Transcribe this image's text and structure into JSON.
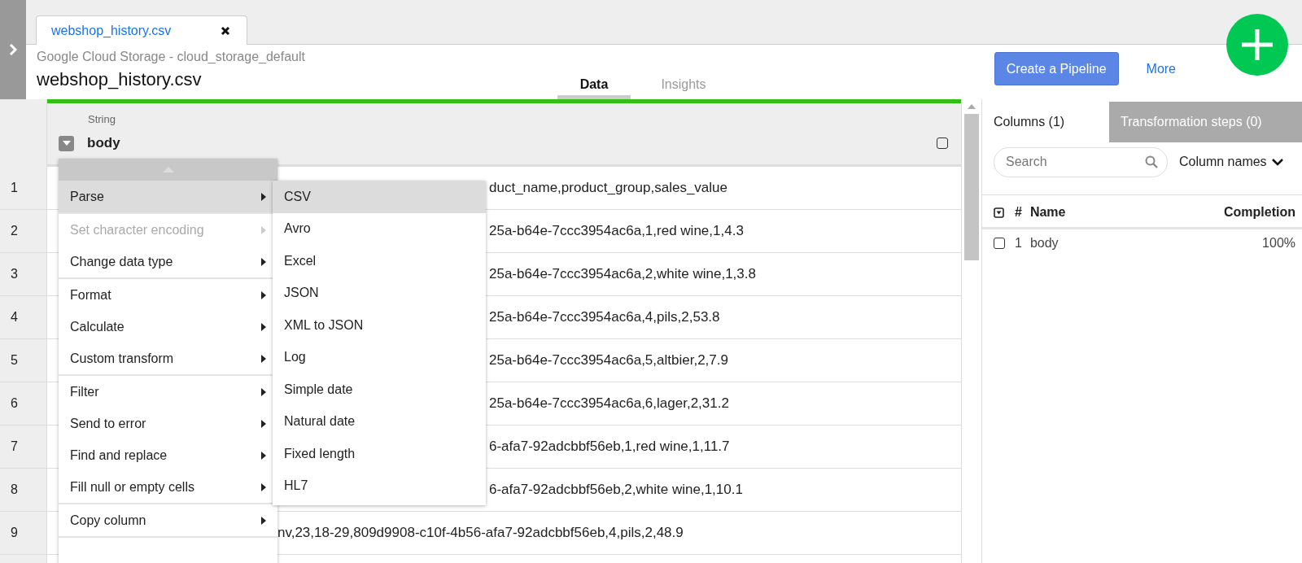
{
  "file_tab": {
    "label": "webshop_history.csv"
  },
  "header": {
    "source": "Google Cloud Storage - cloud_storage_default",
    "title": "webshop_history.csv"
  },
  "view_tabs": [
    {
      "label": "Data",
      "selected": true
    },
    {
      "label": "Insights",
      "selected": false
    }
  ],
  "actions": {
    "primary": "Create a Pipeline",
    "link": "More"
  },
  "table": {
    "column": {
      "type": "String",
      "name": "body",
      "checked": false
    },
    "rows": [
      {
        "number": "1",
        "value": "duct_name,product_group,sales_value"
      },
      {
        "number": "2",
        "value": "25a-b64e-7ccc3954ac6a,1,red wine,1,4.3"
      },
      {
        "number": "3",
        "value": "25a-b64e-7ccc3954ac6a,2,white wine,1,3.8"
      },
      {
        "number": "4",
        "value": "25a-b64e-7ccc3954ac6a,4,pils,2,53.8"
      },
      {
        "number": "5",
        "value": "25a-b64e-7ccc3954ac6a,5,altbier,2,7.9"
      },
      {
        "number": "6",
        "value": "25a-b64e-7ccc3954ac6a,6,lager,2,31.2"
      },
      {
        "number": "7",
        "value": "6-afa7-92adcbbf56eb,1,red wine,1,11.7"
      },
      {
        "number": "8",
        "value": "6-afa7-92adcbbf56eb,2,white wine,1,10.1"
      },
      {
        "number": "9",
        "value": "nv,23,18-29,809d9908-c10f-4b56-afa7-92adcbbf56eb,4,pils,2,48.9"
      }
    ]
  },
  "context_menu": {
    "groups": [
      [
        {
          "label": "Parse",
          "selected": true,
          "disabled": false
        }
      ],
      [
        {
          "label": "Set character encoding",
          "selected": false,
          "disabled": true
        },
        {
          "label": "Change data type",
          "selected": false,
          "disabled": false
        }
      ],
      [
        {
          "label": "Format",
          "selected": false,
          "disabled": false
        },
        {
          "label": "Calculate",
          "selected": false,
          "disabled": false
        },
        {
          "label": "Custom transform",
          "selected": false,
          "disabled": false
        }
      ],
      [
        {
          "label": "Filter",
          "selected": false,
          "disabled": false
        },
        {
          "label": "Send to error",
          "selected": false,
          "disabled": false
        },
        {
          "label": "Find and replace",
          "selected": false,
          "disabled": false
        },
        {
          "label": "Fill null or empty cells",
          "selected": false,
          "disabled": false
        }
      ],
      [
        {
          "label": "Copy column",
          "selected": false,
          "disabled": false
        }
      ]
    ]
  },
  "submenu": {
    "items": [
      {
        "label": "CSV",
        "selected": true
      },
      {
        "label": "Avro",
        "selected": false
      },
      {
        "label": "Excel",
        "selected": false
      },
      {
        "label": "JSON",
        "selected": false
      },
      {
        "label": "XML to JSON",
        "selected": false
      },
      {
        "label": "Log",
        "selected": false
      },
      {
        "label": "Simple date",
        "selected": false
      },
      {
        "label": "Natural date",
        "selected": false
      },
      {
        "label": "Fixed length",
        "selected": false
      },
      {
        "label": "HL7",
        "selected": false
      }
    ]
  },
  "side_panel": {
    "tabs": [
      {
        "label": "Columns (1)",
        "selected": true
      },
      {
        "label": "Transformation steps (0)",
        "selected": false
      }
    ],
    "search": {
      "placeholder": "Search"
    },
    "view_select": "Column names",
    "columns_table": {
      "headers": {
        "number": "#",
        "name": "Name",
        "completion": "Completion"
      },
      "rows": [
        {
          "number": "1",
          "name": "body",
          "completion": "100%",
          "checked": false
        }
      ]
    }
  }
}
